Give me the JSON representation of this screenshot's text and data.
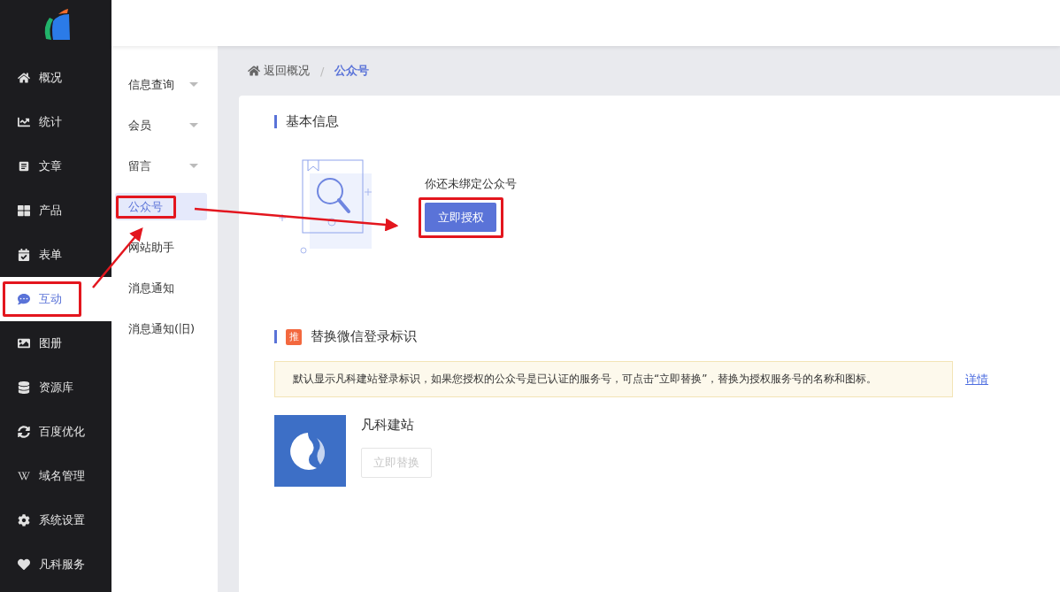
{
  "nav": [
    {
      "label": "概况",
      "selected": false,
      "highlighted": false
    },
    {
      "label": "统计",
      "selected": false,
      "highlighted": false
    },
    {
      "label": "文章",
      "selected": false,
      "highlighted": false
    },
    {
      "label": "产品",
      "selected": false,
      "highlighted": false
    },
    {
      "label": "表单",
      "selected": false,
      "highlighted": false
    },
    {
      "label": "互动",
      "selected": true,
      "highlighted": true
    },
    {
      "label": "图册",
      "selected": false,
      "highlighted": false
    },
    {
      "label": "资源库",
      "selected": false,
      "highlighted": false
    },
    {
      "label": "百度优化",
      "selected": false,
      "highlighted": false
    },
    {
      "label": "域名管理",
      "selected": false,
      "highlighted": false
    },
    {
      "label": "系统设置",
      "selected": false,
      "highlighted": false
    },
    {
      "label": "凡科服务",
      "selected": false,
      "highlighted": false
    }
  ],
  "submenu": [
    {
      "label": "信息查询",
      "expandable": true,
      "selected": false,
      "highlighted": false
    },
    {
      "label": "会员",
      "expandable": true,
      "selected": false,
      "highlighted": false
    },
    {
      "label": "留言",
      "expandable": true,
      "selected": false,
      "highlighted": false
    },
    {
      "label": "公众号",
      "expandable": false,
      "selected": true,
      "highlighted": true
    },
    {
      "label": "网站助手",
      "expandable": false,
      "selected": false,
      "highlighted": false
    },
    {
      "label": "消息通知",
      "expandable": false,
      "selected": false,
      "highlighted": false
    },
    {
      "label": "消息通知(旧)",
      "expandable": false,
      "selected": false,
      "highlighted": false
    }
  ],
  "breadcrumb": {
    "back": "返回概况",
    "separator": "/",
    "current": "公众号"
  },
  "basic_info": {
    "title": "基本信息",
    "message": "你还未绑定公众号",
    "button": {
      "label": "立即授权",
      "highlighted": true
    }
  },
  "replace_section": {
    "badge": "推",
    "title": "替换微信登录标识",
    "notice": "默认显示凡科建站登录标识，如果您授权的公众号是已认证的服务号，可点击“立即替换”，替换为授权服务号的名称和图标。",
    "notice_link": "详情",
    "brand_name": "凡科建站",
    "button": {
      "label": "立即替换",
      "disabled": true
    }
  }
}
